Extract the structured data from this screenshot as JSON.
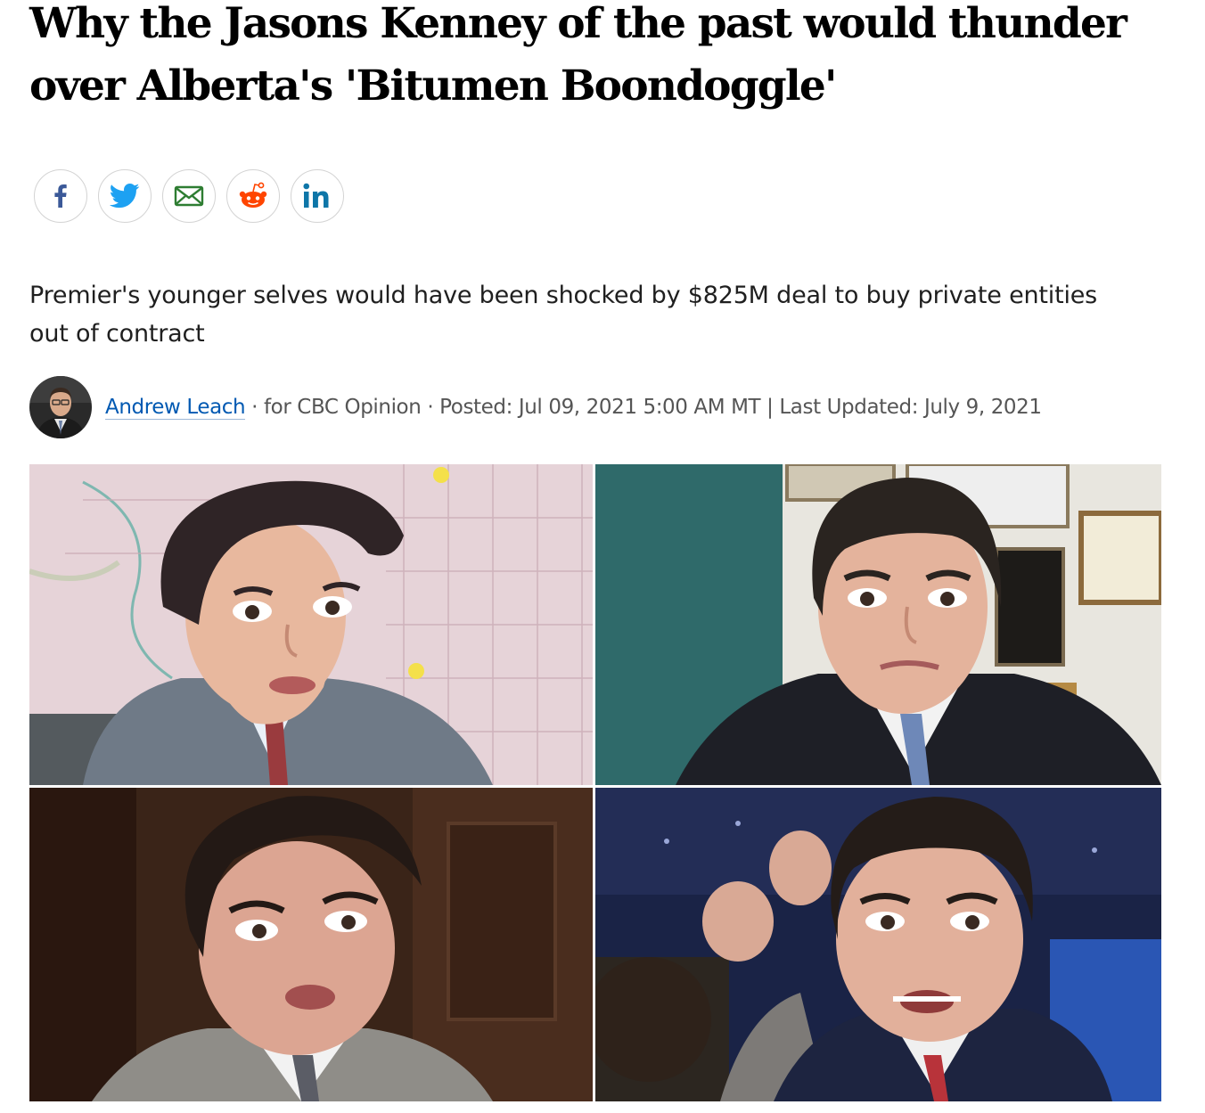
{
  "article": {
    "headline": "Why the Jasons Kenney of the past would thunder over Alberta's 'Bitumen Boondoggle'",
    "deck": "Premier's younger selves would have been shocked by $825M deal to buy private entities out of contract"
  },
  "share": {
    "buttons": [
      {
        "network": "facebook",
        "icon": "facebook-icon",
        "color": "#3b5998"
      },
      {
        "network": "twitter",
        "icon": "twitter-icon",
        "color": "#1da1f2"
      },
      {
        "network": "email",
        "icon": "email-icon",
        "color": "#2e7d32"
      },
      {
        "network": "reddit",
        "icon": "reddit-icon",
        "color": "#ff4500"
      },
      {
        "network": "linkedin",
        "icon": "linkedin-icon",
        "color": "#0e76a8"
      }
    ]
  },
  "byline": {
    "author": "Andrew Leach",
    "separator1": " · ",
    "outlet": "for CBC Opinion",
    "separator2": " · ",
    "posted": "Posted: Jul 09, 2021 5:00 AM MT",
    "separator3": " | ",
    "updated": "Last Updated: July 9, 2021"
  },
  "image": {
    "description_panels": [
      "jason-kenney-young-map",
      "jason-kenney-office",
      "jason-kenney-young-dark",
      "jason-kenney-convention"
    ]
  },
  "colors": {
    "link": "#0059b2",
    "text": "#1f1f1f",
    "meta": "#555555"
  }
}
